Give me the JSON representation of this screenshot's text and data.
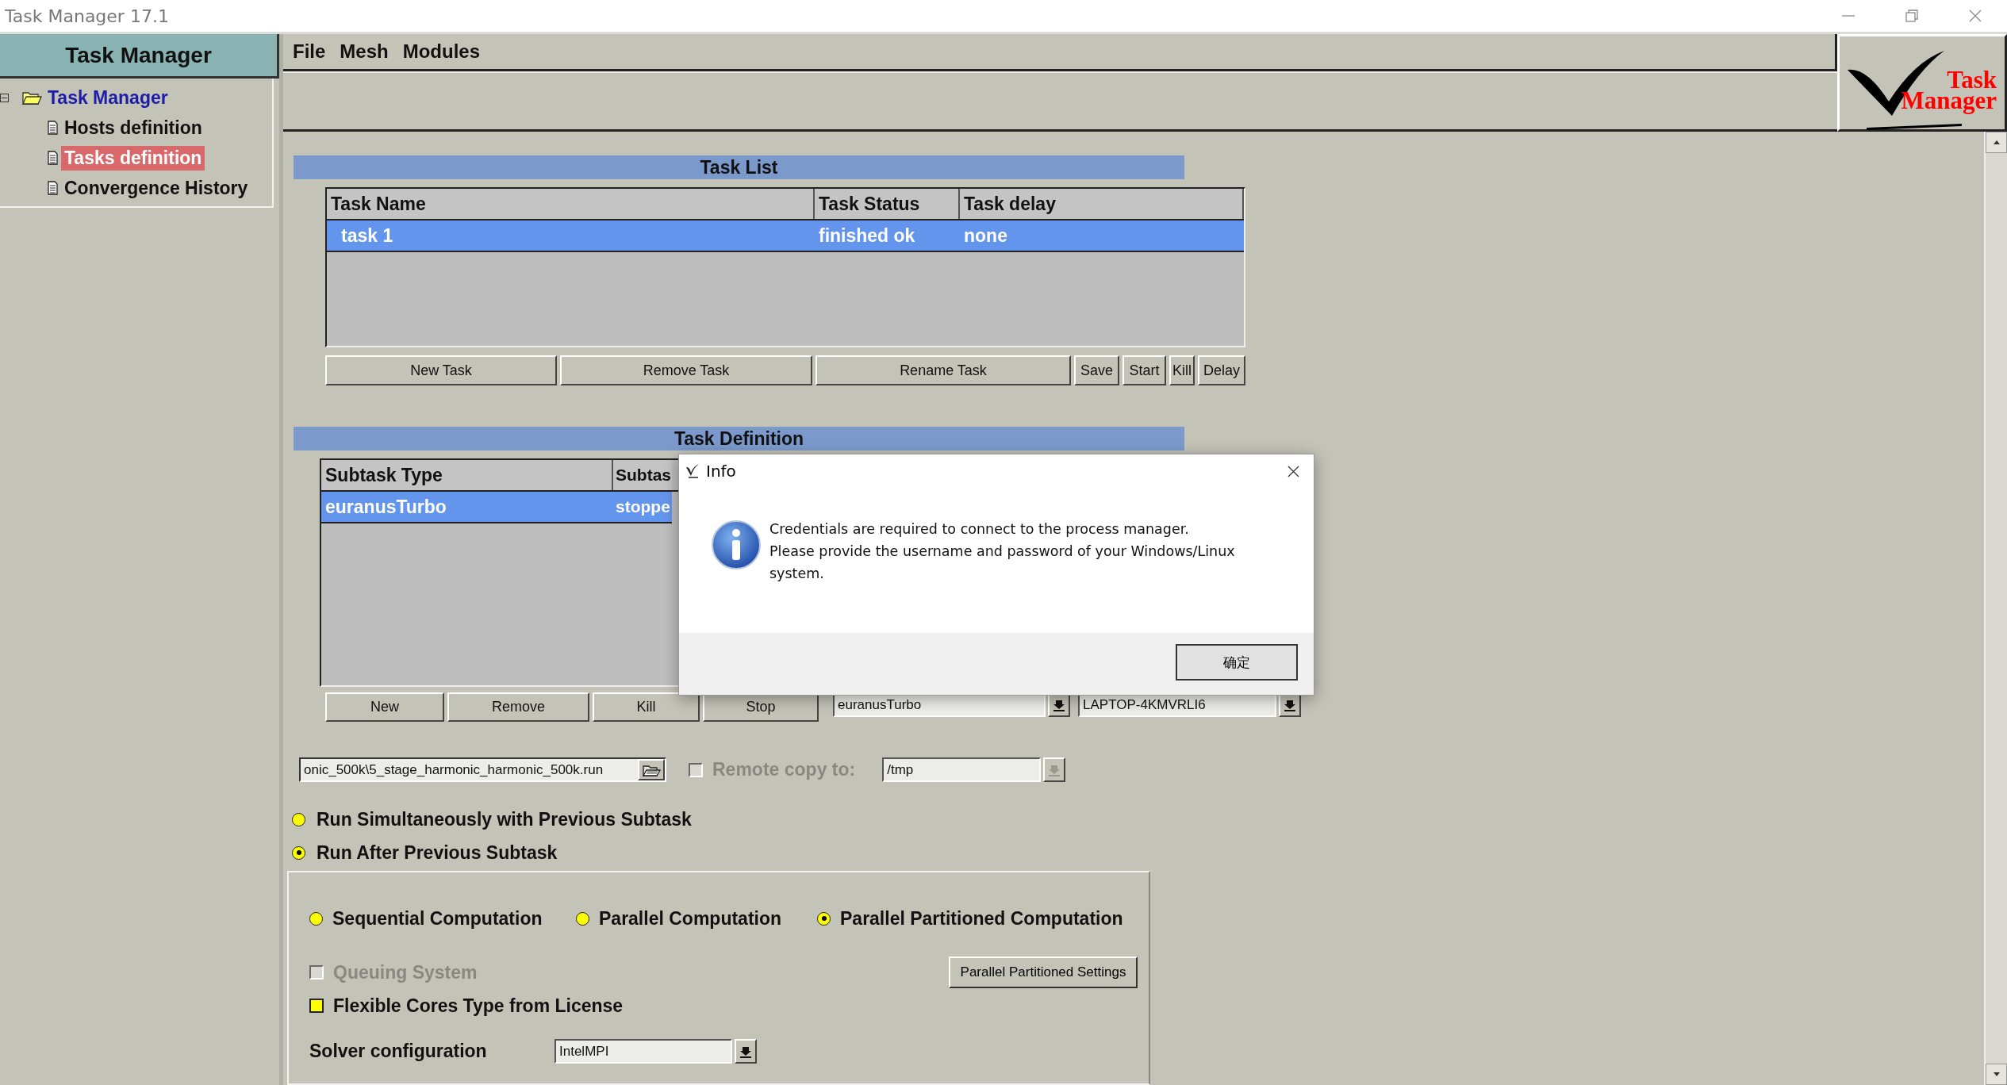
{
  "window": {
    "title": "Task Manager 17.1"
  },
  "sidebar": {
    "title": "Task Manager",
    "tree": [
      {
        "label": "Task Manager",
        "expanded": true,
        "children": [
          {
            "label": "Hosts definition",
            "selected": false
          },
          {
            "label": "Tasks definition",
            "selected": true
          },
          {
            "label": "Convergence History",
            "selected": false
          }
        ]
      }
    ]
  },
  "menu": [
    "File",
    "Mesh",
    "Modules"
  ],
  "logo": {
    "line_1": "Task",
    "line_2": "Manager"
  },
  "task_list": {
    "title": "Task List",
    "columns": [
      "Task Name",
      "Task Status",
      "Task delay"
    ],
    "rows": [
      {
        "cells": [
          "task 1",
          "finished ok",
          "none"
        ],
        "selected": true
      }
    ],
    "buttons": [
      "New Task",
      "Remove Task",
      "Rename Task",
      "Save",
      "Start",
      "Kill",
      "Delay"
    ]
  },
  "task_definition": {
    "title": "Task Definition",
    "columns": [
      "Subtask Type",
      "Subtas"
    ],
    "rows": [
      {
        "cells": [
          "euranusTurbo",
          "stoppe"
        ],
        "selected": true
      }
    ],
    "buttons": [
      "New",
      "Remove",
      "Kill",
      "Stop"
    ],
    "subtask_type_combo": {
      "value": "euranusTurbo"
    },
    "host_combo": {
      "value": "LAPTOP-4KMVRLI6"
    }
  },
  "run_file": {
    "value": "onic_500k\\5_stage_harmonic_harmonic_500k.run"
  },
  "remote_copy": {
    "label": "Remote copy to:",
    "checked": false,
    "disabled": true,
    "value": "/tmp"
  },
  "run_order": [
    {
      "label": "Run Simultaneously with Previous Subtask",
      "selected": false
    },
    {
      "label": "Run After Previous Subtask",
      "selected": true
    }
  ],
  "computation": [
    {
      "label": "Sequential Computation",
      "selected": false
    },
    {
      "label": "Parallel Computation",
      "selected": false
    },
    {
      "label": "Parallel Partitioned Computation",
      "selected": true
    }
  ],
  "queuing_system": {
    "label": "Queuing System",
    "checked": false,
    "disabled": true
  },
  "partition_settings_button": "Parallel Partitioned Settings",
  "flexible_cores": {
    "label": "Flexible Cores Type from License",
    "checked": false,
    "disabled": false
  },
  "solver_configuration": {
    "label": "Solver configuration",
    "value": "IntelMPI"
  },
  "dialog": {
    "title": "Info",
    "message": "Credentials are required to connect to the process manager.\nPlease provide the username and password of your Windows/Linux\nsystem.",
    "button": "确定"
  }
}
